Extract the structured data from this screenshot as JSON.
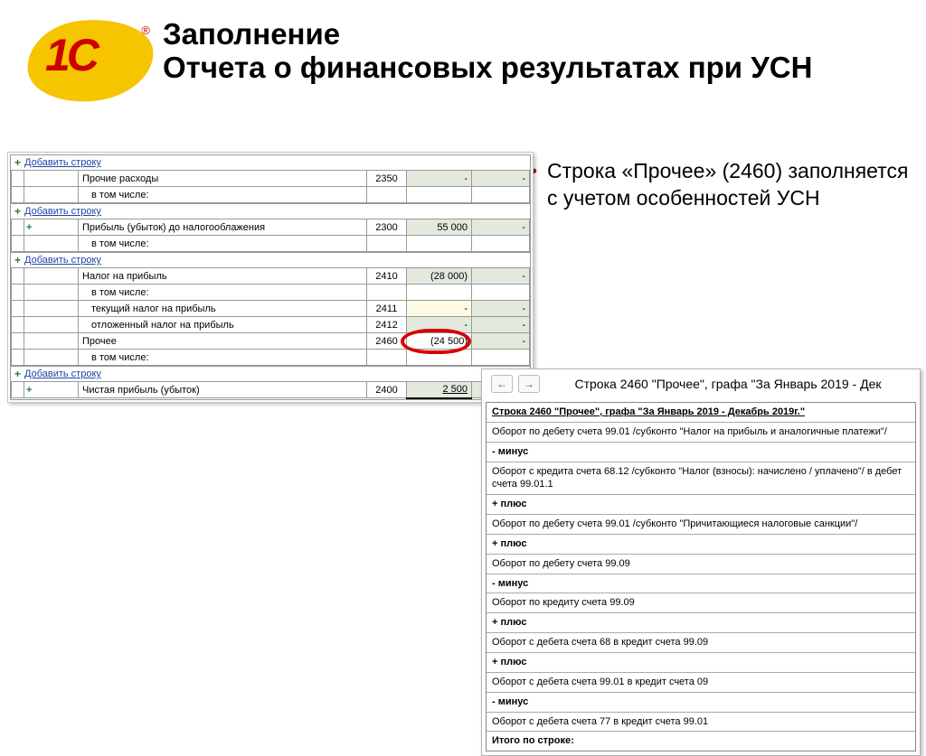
{
  "slide": {
    "title": "Заполнение\nОтчета о финансовых результатах при УСН",
    "logo_text": "1С",
    "logo_reg": "®",
    "bullet": "Строка «Прочее» (2460) заполняется с учетом особенностей УСН"
  },
  "report": {
    "add_link": "Добавить строку",
    "rows": [
      {
        "name": "Прочие расходы",
        "code": "2350",
        "v1": "-",
        "v2": "-",
        "shade1": true,
        "shade2": true
      },
      {
        "name": "в том числе:",
        "code": "",
        "v1": "",
        "v2": "",
        "sub": true
      },
      {
        "name": "Прибыль (убыток) до налогооблажения",
        "code": "2300",
        "v1": "55 000",
        "v2": "-",
        "shade1": true,
        "shade2": true,
        "indent": true
      },
      {
        "name": "в том числе:",
        "code": "",
        "v1": "",
        "v2": "",
        "sub": true,
        "indent": true
      },
      {
        "name": "Налог на прибыль",
        "code": "2410",
        "v1": "(28 000)",
        "v2": "-",
        "shade1": true,
        "shade2": true
      },
      {
        "name": "в том числе:",
        "code": "",
        "v1": "",
        "v2": "",
        "sub": true
      },
      {
        "name": "текущий налог на прибыль",
        "code": "2411",
        "v1": "-",
        "v2": "-",
        "sub": true,
        "yellow1": true,
        "shade2": true
      },
      {
        "name": "отложенный налог на прибыль",
        "code": "2412",
        "v1": "-",
        "v2": "-",
        "sub": true,
        "shade1": true,
        "shade2": true
      },
      {
        "name": "Прочее",
        "code": "2460",
        "v1": "(24 500)",
        "v2": "-",
        "highlight": true,
        "shade2": true
      },
      {
        "name": "в том числе:",
        "code": "",
        "v1": "",
        "v2": "",
        "sub": true
      },
      {
        "name": "Чистая прибыль (убыток)",
        "code": "2400",
        "v1": "2 500",
        "v2": "-",
        "indent": true,
        "shade1": true,
        "shade2": true,
        "underline": true
      }
    ]
  },
  "detail": {
    "title": "Строка 2460 \"Прочее\", графа \"За Январь 2019 - Дек",
    "header_row": "Строка 2460 \"Прочее\", графа \"За Январь 2019 - Декабрь 2019г.\"",
    "lines": [
      {
        "t": "Оборот по дебету счета 99.01 /субконто \"Налог на прибыль и аналогичные платежи\"/"
      },
      {
        "op": "- минус"
      },
      {
        "t": "Оборот с кредита счета 68.12 /субконто \"Налог (взносы): начислено / уплачено\"/ в дебет счета 99.01.1"
      },
      {
        "op": "+ плюс"
      },
      {
        "t": "Оборот по дебету счета 99.01 /субконто \"Причитающиеся налоговые санкции\"/"
      },
      {
        "op": "+ плюс"
      },
      {
        "t": "Оборот по дебету счета 99.09"
      },
      {
        "op": "- минус"
      },
      {
        "t": "Оборот по кредиту счета 99.09"
      },
      {
        "op": "+ плюс"
      },
      {
        "t": "Оборот с дебета счета 68 в кредит счета 99.09"
      },
      {
        "op": "+ плюс"
      },
      {
        "t": "Оборот с дебета счета 99.01 в кредит счета 09"
      },
      {
        "op": "- минус"
      },
      {
        "t": "Оборот с дебета счета 77 в кредит счета 99.01"
      }
    ],
    "total": "Итого по строке:"
  }
}
